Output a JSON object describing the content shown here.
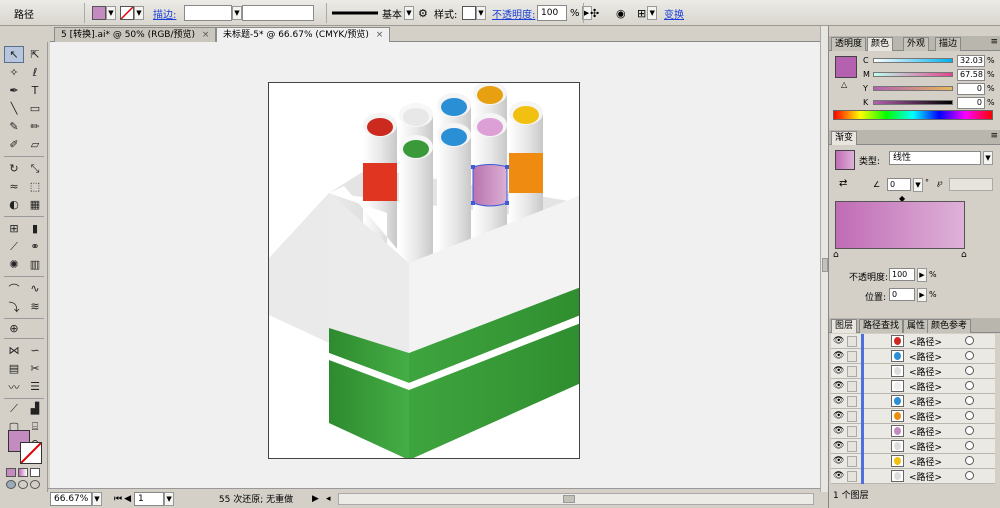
{
  "control_bar": {
    "object_type": "路径",
    "fill_color": "#c48bc0",
    "stroke_label": "描边:",
    "stroke_weight": "",
    "brush_style": "",
    "profile_label": "基本",
    "style_label": "样式:",
    "opacity_label": "不透明度:",
    "opacity_value": "100",
    "opacity_unit": "%",
    "transform_label": "变换"
  },
  "document_tabs": [
    {
      "label": "5 [转换].ai* @ 50% (RGB/预览)",
      "close": "×"
    },
    {
      "label": "未标题-5* @ 66.67% (CMYK/预览)",
      "close": "×"
    }
  ],
  "status_bar": {
    "zoom": "66.67%",
    "page": "1",
    "history": "55 次还原; 无重做"
  },
  "color_panel": {
    "tabs": [
      "透明度",
      "颜色",
      "外观",
      "描边"
    ],
    "active_tab": "颜色",
    "fill_color": "#b461b0",
    "sliders": [
      {
        "label": "C",
        "value": "32.03"
      },
      {
        "label": "M",
        "value": "67.58"
      },
      {
        "label": "Y",
        "value": "0"
      },
      {
        "label": "K",
        "value": "0"
      }
    ],
    "unit": "%"
  },
  "gradient_panel": {
    "tab": "渐变",
    "type_label": "类型:",
    "type_value": "线性",
    "angle_value": "0",
    "degree_symbol": "°",
    "gradient_start": "#c06cb5",
    "gradient_end": "#dfb1d8",
    "opacity_label": "不透明度:",
    "opacity_value": "100",
    "location_label": "位置:",
    "location_value": "0",
    "unit": "%"
  },
  "layers_panel": {
    "tabs": [
      "图层",
      "路径查找",
      "属性",
      "颜色参考"
    ],
    "active_tab": "图层",
    "rows": [
      {
        "name": "<路径>",
        "color": "#cc2a1e"
      },
      {
        "name": "<路径>",
        "color": "#2b8fd6"
      },
      {
        "name": "<路径>",
        "color": "#dddddd"
      },
      {
        "name": "<路径>",
        "color": "#eeeeee"
      },
      {
        "name": "<路径>",
        "color": "#2b8fd6"
      },
      {
        "name": "<路径>",
        "color": "#ee8b10"
      },
      {
        "name": "<路径>",
        "color": "#c48bc0"
      },
      {
        "name": "<路径>",
        "color": "#dddddd"
      },
      {
        "name": "<路径>",
        "color": "#f2c010"
      },
      {
        "name": "<路径>",
        "color": "#dddddd"
      }
    ],
    "footer": "1 个图层"
  },
  "artwork": {
    "marker_caps": [
      "#cc2a1e",
      "#eeeeee",
      "#2b8fd6",
      "#2b8fd6",
      "#3a9a3a",
      "#e6a010",
      "#dda0d6",
      "#f2c010"
    ],
    "band_colors": [
      "#e03520",
      "#c48bc0",
      "#ee8b10"
    ],
    "box_green": "#3aa03a",
    "box_white": "#f2f2f2"
  }
}
